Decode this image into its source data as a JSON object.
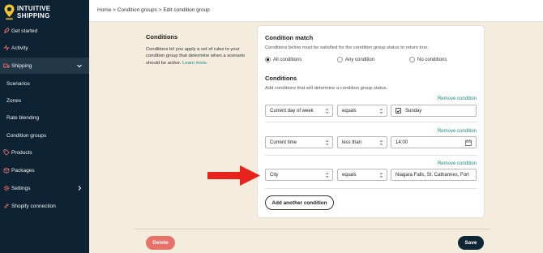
{
  "app": {
    "brand_line1": "INTUITIVE",
    "brand_line2": "SHIPPING"
  },
  "colors": {
    "sidebar": "#0d2233",
    "accent": "#1a8a8a",
    "page_bg": "#f4ecdc",
    "delete": "#e8716a",
    "save": "#0f2637",
    "arrow": "#e8231b"
  },
  "sidebar": {
    "items": [
      {
        "label": "Get started",
        "icon": "rocket-icon"
      },
      {
        "label": "Activity",
        "icon": "pulse-icon"
      },
      {
        "label": "Shipping",
        "icon": "truck-icon"
      },
      {
        "label": "Scenarios"
      },
      {
        "label": "Zones"
      },
      {
        "label": "Rate blending"
      },
      {
        "label": "Condition groups"
      },
      {
        "label": "Products",
        "icon": "tag-icon"
      },
      {
        "label": "Packages",
        "icon": "box-icon"
      },
      {
        "label": "Settings",
        "icon": "gear-icon"
      },
      {
        "label": "Shopify connection",
        "icon": "link-icon"
      }
    ]
  },
  "breadcrumb": {
    "home": "Home",
    "sep1": ">",
    "groups": "Condition groups",
    "sep2": ">",
    "current": "Edit condition group"
  },
  "intro": {
    "title": "Conditions",
    "body": "Conditions let you apply a set of rules to your condition group that determine when a scenario should be active.",
    "link": "Learn more."
  },
  "match": {
    "title": "Condition match",
    "help": "Conditions below must be satisfied for the condition group status to return true.",
    "options": [
      "All conditions",
      "Any condition",
      "No conditions"
    ],
    "selected": "All conditions"
  },
  "conditions": {
    "title": "Conditions",
    "help": "Add conditions that will determine a condition group status.",
    "remove_label": "Remove condition",
    "rows": [
      {
        "field": "Current day of week",
        "operator": "equals",
        "value": "Sunday",
        "value_type": "checkbox"
      },
      {
        "field": "Current time",
        "operator": "less than",
        "value": "14:00",
        "value_type": "time"
      },
      {
        "field": "City",
        "operator": "equals",
        "value": "Niagara Falls, St. Cathannes, Fort",
        "value_type": "text"
      }
    ],
    "add_label": "Add another condition"
  },
  "footer": {
    "delete_label": "Delete",
    "save_label": "Save"
  }
}
